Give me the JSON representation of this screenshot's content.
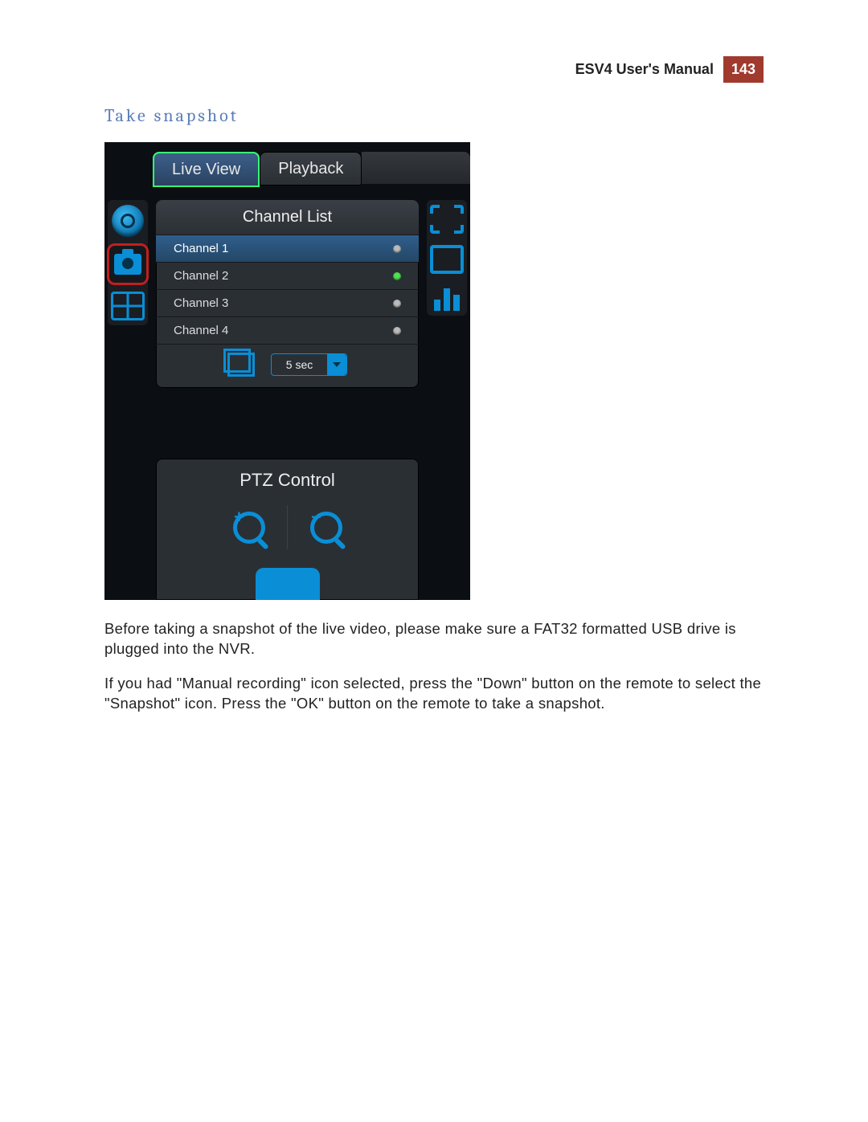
{
  "header": {
    "manual_title": "ESV4 User's Manual",
    "page_number": "143"
  },
  "section_title": "Take snapshot",
  "screenshot": {
    "tabs": {
      "live": "Live View",
      "playback": "Playback"
    },
    "left_icons": {
      "record": "record-icon",
      "snapshot": "camera-icon",
      "multiview": "grid-icon"
    },
    "right_icons": {
      "fullscreen": "fullscreen-icon",
      "single": "single-view-icon",
      "stats": "bars-icon"
    },
    "channel_panel": {
      "title": "Channel List",
      "channels": [
        {
          "label": "Channel 1",
          "status": "off",
          "selected": true
        },
        {
          "label": "Channel 2",
          "status": "on",
          "selected": false
        },
        {
          "label": "Channel 3",
          "status": "off",
          "selected": false
        },
        {
          "label": "Channel 4",
          "status": "off",
          "selected": false
        }
      ],
      "dwell_value": "5 sec"
    },
    "ptz": {
      "title": "PTZ Control",
      "zoom_in": "+",
      "zoom_out": "−"
    }
  },
  "paragraphs": {
    "p1": "Before taking a snapshot of the live video, please make sure a FAT32 formatted USB drive is plugged into the NVR.",
    "p2": "If you had \"Manual recording\" icon selected, press the \"Down\" button on the remote to select the \"Snapshot\" icon. Press the \"OK\" button on the remote to take a snapshot."
  }
}
